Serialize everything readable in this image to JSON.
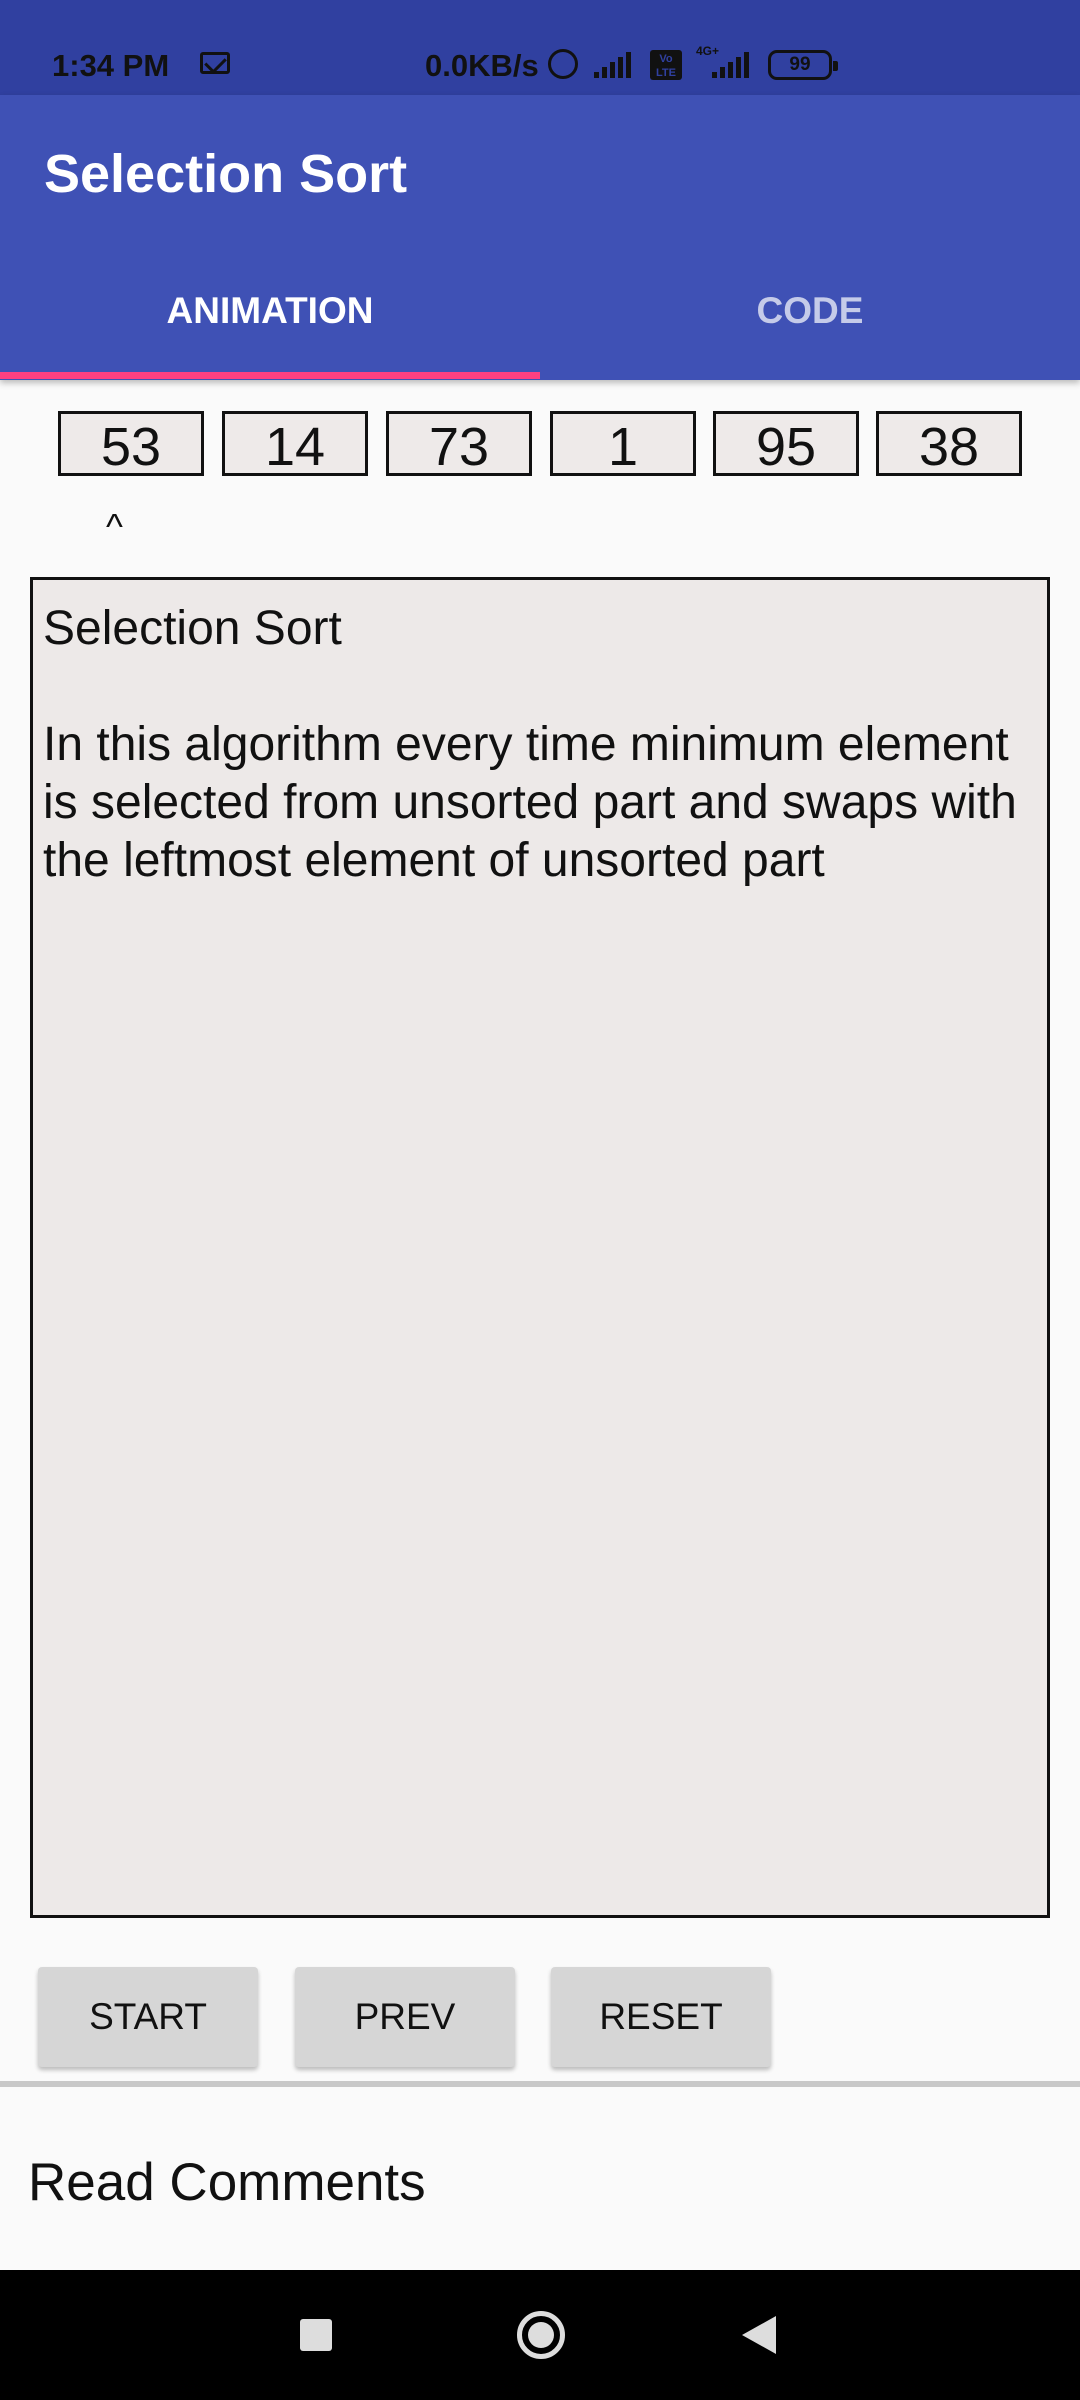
{
  "status_bar": {
    "time": "1:34 PM",
    "network_speed": "0.0KB/s",
    "network_type": "4G+",
    "volte": "Vo LTE",
    "battery": "99",
    "icons": [
      "mail-icon",
      "alarm-icon",
      "signal-icon",
      "volte-icon",
      "signal-icon",
      "battery-icon"
    ]
  },
  "app_bar": {
    "title": "Selection Sort",
    "tabs": [
      {
        "label": "ANIMATION",
        "active": true
      },
      {
        "label": "CODE",
        "active": false
      }
    ],
    "colors": {
      "primary": "#3f51b5",
      "status": "#3040a0",
      "accent": "#ff4081"
    }
  },
  "array": {
    "values": [
      "53",
      "14",
      "73",
      "1",
      "95",
      "38"
    ],
    "pointer": "^",
    "pointer_index": 0
  },
  "description": {
    "text": "Selection Sort\n\nIn this algorithm every time minimum element is selected from unsorted part and swaps with the leftmost element of unsorted part"
  },
  "controls": {
    "start_label": "START",
    "prev_label": "PREV",
    "reset_label": "RESET"
  },
  "comments": {
    "label": "Read Comments"
  },
  "nav_bar": {
    "icons": [
      "recents-square-icon",
      "home-circle-icon",
      "back-triangle-icon"
    ]
  }
}
